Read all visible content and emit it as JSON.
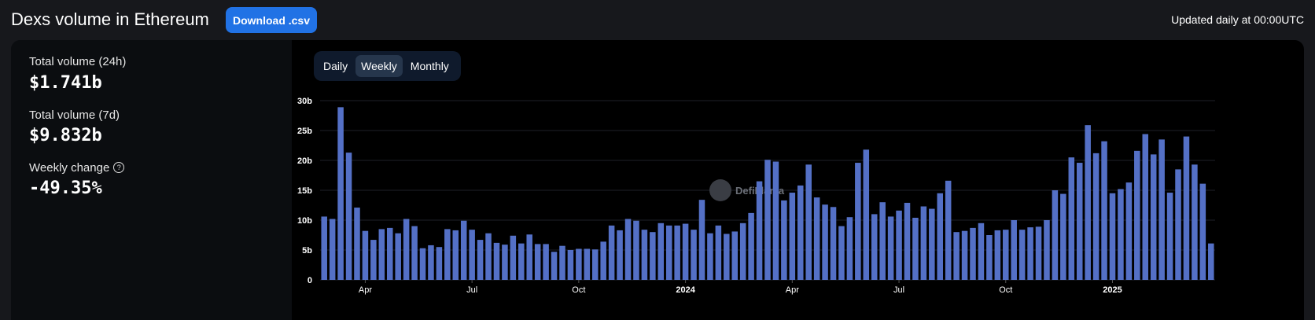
{
  "header": {
    "title": "Dexs volume in Ethereum",
    "download_label": "Download .csv",
    "updated_text": "Updated daily at 00:00UTC"
  },
  "stats": {
    "vol24h_label": "Total volume (24h)",
    "vol24h_value": "$1.741b",
    "vol7d_label": "Total volume (7d)",
    "vol7d_value": "$9.832b",
    "change_label": "Weekly change",
    "change_value": "-49.35%"
  },
  "tabs": [
    {
      "label": "Daily",
      "active": false
    },
    {
      "label": "Weekly",
      "active": true
    },
    {
      "label": "Monthly",
      "active": false
    }
  ],
  "watermark": "DefiLlama",
  "colors": {
    "bar": "#5470c6",
    "accent": "#2172e5"
  },
  "chart_data": {
    "type": "bar",
    "ylim": [
      0,
      30
    ],
    "yticks": [
      "0",
      "5b",
      "10b",
      "15b",
      "20b",
      "25b",
      "30b"
    ],
    "x_labels": [
      {
        "label": "Apr",
        "bar_index": 5,
        "bold": false
      },
      {
        "label": "Jul",
        "bar_index": 18,
        "bold": false
      },
      {
        "label": "Oct",
        "bar_index": 31,
        "bold": false
      },
      {
        "label": "2024",
        "bar_index": 44,
        "bold": true
      },
      {
        "label": "Apr",
        "bar_index": 57,
        "bold": false
      },
      {
        "label": "Jul",
        "bar_index": 70,
        "bold": false
      },
      {
        "label": "Oct",
        "bar_index": 83,
        "bold": false
      },
      {
        "label": "2025",
        "bar_index": 96,
        "bold": true
      }
    ],
    "series": [
      {
        "values": [
          10.6,
          10.2,
          28.9,
          21.3,
          12.1,
          8.2,
          6.7,
          8.5,
          8.7,
          7.8,
          10.2,
          9.0,
          5.3,
          5.8,
          5.5,
          8.5,
          8.3,
          9.9,
          8.4,
          6.7,
          7.8,
          6.2,
          5.9,
          7.4,
          6.1,
          7.6,
          6.0,
          6.0,
          4.7,
          5.7,
          5.0,
          5.2,
          5.2,
          5.1,
          6.4,
          9.1,
          8.3,
          10.2,
          9.9,
          8.4,
          8.0,
          9.5,
          9.1,
          9.1,
          9.4,
          8.4,
          13.4,
          7.8,
          9.1,
          7.7,
          8.1,
          9.5,
          11.2,
          16.5,
          20.1,
          19.8,
          13.3,
          14.6,
          15.8,
          19.3,
          13.8,
          12.6,
          12.2,
          9.0,
          10.5,
          19.6,
          21.8,
          11.0,
          13.0,
          10.6,
          11.6,
          12.9,
          10.4,
          12.3,
          11.9,
          14.5,
          16.6,
          8.0,
          8.2,
          8.7,
          9.5,
          7.5,
          8.3,
          8.4,
          10.0,
          8.4,
          8.8,
          8.9,
          10.0,
          15.0,
          14.4,
          20.5,
          19.6,
          25.9,
          21.2,
          23.2,
          14.5,
          15.2,
          16.3,
          21.6,
          24.4,
          21.0,
          23.5,
          14.6,
          18.5,
          24.0,
          19.3,
          16.1,
          6.1
        ]
      }
    ]
  }
}
